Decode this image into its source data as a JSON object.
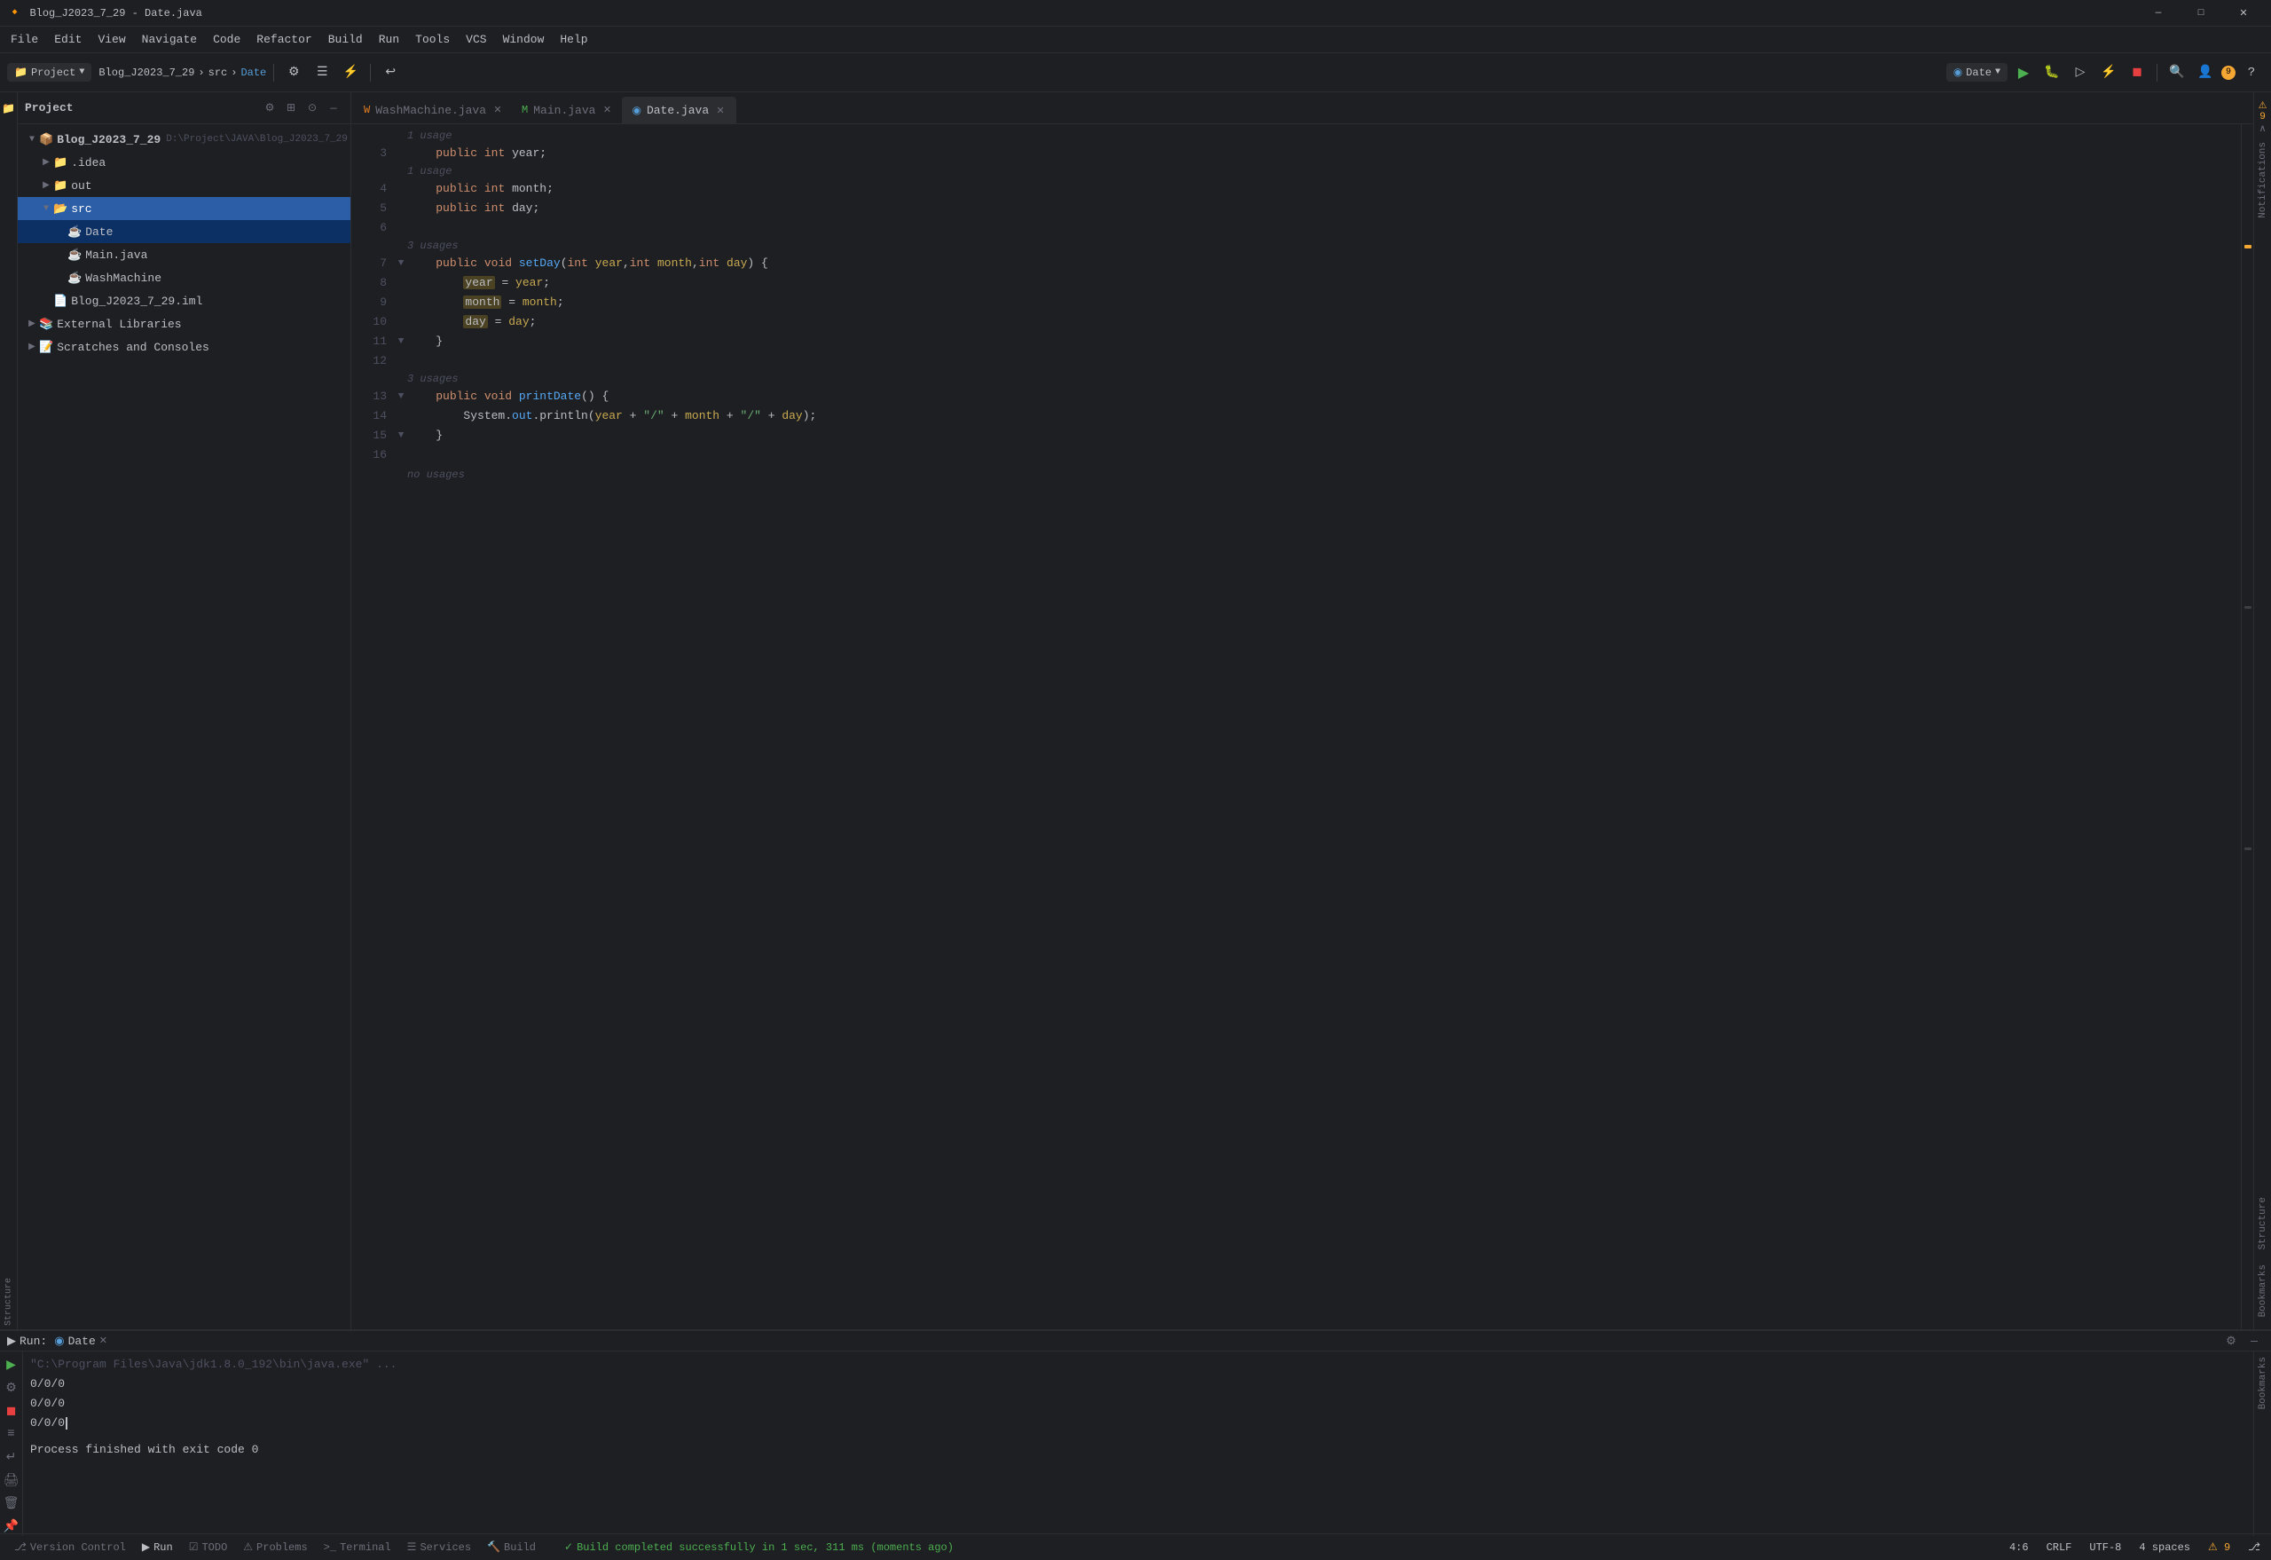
{
  "window": {
    "title": "Blog_J2023_7_29 - Date.java",
    "controls": {
      "minimize": "—",
      "maximize": "□",
      "close": "✕"
    }
  },
  "menubar": {
    "items": [
      "File",
      "Edit",
      "View",
      "Navigate",
      "Code",
      "Refactor",
      "Build",
      "Run",
      "Tools",
      "VCS",
      "Window",
      "Help"
    ]
  },
  "toolbar": {
    "project_dropdown": "Project",
    "config_dropdown": "Date",
    "breadcrumb": {
      "project": "Blog_J2023_7_29",
      "src": "src",
      "file": "Date"
    },
    "path": "D:\\Project\\JAVA\\Blog_J2023_7_29"
  },
  "tabs": [
    {
      "name": "WashMachine.java",
      "icon": "W",
      "active": false
    },
    {
      "name": "Main.java",
      "icon": "M",
      "active": false
    },
    {
      "name": "Date.java",
      "icon": "D",
      "active": true
    }
  ],
  "tree": {
    "items": [
      {
        "level": 0,
        "expanded": true,
        "name": "Blog_J2023_7_29",
        "path": "D:\\Project\\JAVA\\Blog_J2023_7_29",
        "type": "project"
      },
      {
        "level": 1,
        "expanded": false,
        "name": ".idea",
        "type": "folder"
      },
      {
        "level": 1,
        "expanded": false,
        "name": "out",
        "type": "folder"
      },
      {
        "level": 1,
        "expanded": true,
        "name": "src",
        "type": "src-folder",
        "selected": true
      },
      {
        "level": 2,
        "expanded": false,
        "name": "Date",
        "type": "java",
        "active": true
      },
      {
        "level": 2,
        "expanded": false,
        "name": "Main.java",
        "type": "java"
      },
      {
        "level": 2,
        "expanded": false,
        "name": "WashMachine",
        "type": "java"
      },
      {
        "level": 1,
        "expanded": false,
        "name": "Blog_J2023_7_29.iml",
        "type": "xml"
      },
      {
        "level": 0,
        "expanded": false,
        "name": "External Libraries",
        "type": "folder"
      },
      {
        "level": 0,
        "expanded": false,
        "name": "Scratches and Consoles",
        "type": "folder"
      }
    ]
  },
  "editor": {
    "lines": [
      {
        "num": 3,
        "hint": "1 usage",
        "fold": "",
        "code": "    <kw>public</kw> <kw>int</kw> <var>year</var>;"
      },
      {
        "num": 4,
        "hint": "1 usage",
        "fold": "",
        "code": "    <kw>public</kw> <kw>int</kw> <var>month</var>;"
      },
      {
        "num": 5,
        "hint": "",
        "fold": "",
        "code": "    <kw>public</kw> <kw>int</kw> <var>day</var>;"
      },
      {
        "num": 6,
        "hint": "",
        "fold": "",
        "code": ""
      },
      {
        "num": 7,
        "hint": "3 usages",
        "fold": "▼",
        "code": "    <kw>public</kw> <kw>void</kw> <method>setDay</method>(<kw>int</kw> <var>year</var>,<kw>int</kw> <var>month</var>,<kw>int</kw> <var>day</var>) {"
      },
      {
        "num": 8,
        "hint": "",
        "fold": "",
        "code": "        <hl-year>year</hl-year> = <var>year</var>;"
      },
      {
        "num": 9,
        "hint": "",
        "fold": "",
        "code": "        <hl-month>month</hl-month> = <var>month</var>;"
      },
      {
        "num": 10,
        "hint": "",
        "fold": "",
        "code": "        <hl-day>day</hl-day> = <var>day</var>;"
      },
      {
        "num": 11,
        "hint": "",
        "fold": "▼",
        "code": "    }"
      },
      {
        "num": 12,
        "hint": "",
        "fold": "",
        "code": ""
      },
      {
        "num": 13,
        "hint": "3 usages",
        "fold": "▼",
        "code": "    <kw>public</kw> <kw>void</kw> <method>printDate</method>() {"
      },
      {
        "num": 14,
        "hint": "",
        "fold": "",
        "code": "        System.<out>out</out>.println(<var>year</var> + \"/\" + <var>month</var> + \"/\" + <var>day</var>);"
      },
      {
        "num": 15,
        "hint": "",
        "fold": "▼",
        "code": "    }"
      },
      {
        "num": 16,
        "hint": "",
        "fold": "",
        "code": ""
      }
    ],
    "no_usages_hint": "no usages"
  },
  "run_panel": {
    "label": "Run:",
    "tab_name": "Date",
    "command": "\"C:\\Program Files\\Java\\jdk1.8.0_192\\bin\\java.exe\" ...",
    "output_lines": [
      "0/0/0",
      "0/0/0",
      "0/0/0"
    ],
    "process_end": "Process finished with exit code 0"
  },
  "bottom_tabs": [
    {
      "name": "Version Control",
      "icon": "⎇"
    },
    {
      "name": "Run",
      "icon": "▶",
      "active": true
    },
    {
      "name": "TODO",
      "icon": "☑"
    },
    {
      "name": "Problems",
      "icon": "⚠"
    },
    {
      "name": "Terminal",
      "icon": ">"
    },
    {
      "name": "Services",
      "icon": "☰"
    },
    {
      "name": "Build",
      "icon": "🔨"
    }
  ],
  "statusbar": {
    "warnings": "⚠ 9",
    "position": "4:6",
    "encoding": "CRLF",
    "charset": "UTF-8",
    "indent": "4 spaces",
    "build_message": "Build completed successfully in 1 sec, 311 ms (moments ago)"
  },
  "notifications": {
    "label": "Notifications",
    "badge": "9"
  },
  "right_tools": {
    "items": [
      "Structure",
      "Bookmarks"
    ]
  }
}
